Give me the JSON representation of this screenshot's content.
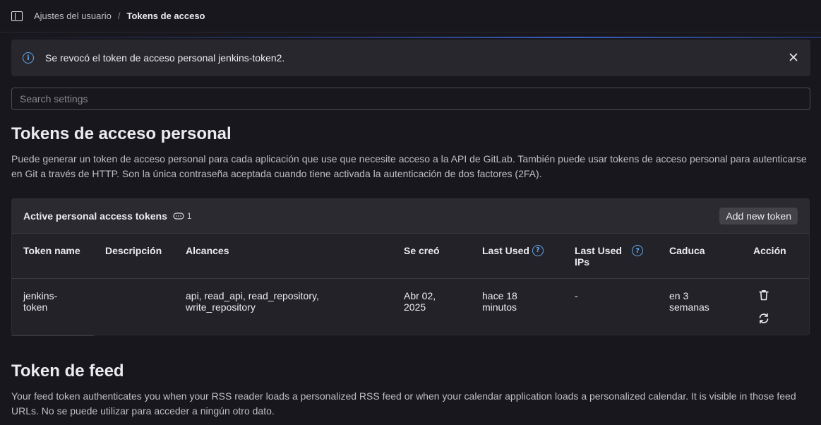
{
  "breadcrumb": {
    "parent": "Ajustes del usuario",
    "separator": "/",
    "current": "Tokens de acceso"
  },
  "alert": {
    "message": "Se revocó el token de acceso personal jenkins-token2."
  },
  "search": {
    "placeholder": "Search settings"
  },
  "pat_section": {
    "title": "Tokens de acceso personal",
    "description": "Puede generar un token de acceso personal para cada aplicación que use que necesite acceso a la API de GitLab. También puede usar tokens de acceso personal para autenticarse en Git a través de HTTP. Son la única contraseña aceptada cuando tiene activada la autenticación de dos factores (2FA)."
  },
  "tokens_card": {
    "title": "Active personal access tokens",
    "count": "1",
    "add_button": "Add new token",
    "columns": {
      "name": "Token name",
      "description": "Descripción",
      "scopes": "Alcances",
      "created": "Se creó",
      "last_used": "Last Used",
      "last_used_ips": "Last Used IPs",
      "expires": "Caduca",
      "action": "Acción"
    },
    "rows": [
      {
        "name": "jenkins-token",
        "description": "",
        "scopes": "api, read_api, read_repository, write_repository",
        "created": "Abr 02, 2025",
        "last_used": "hace 18 minutos",
        "last_used_ips": "-",
        "expires": "en 3 semanas"
      }
    ]
  },
  "feed_section": {
    "title": "Token de feed",
    "description": "Your feed token authenticates you when your RSS reader loads a personalized RSS feed or when your calendar application loads a personalized calendar. It is visible in those feed URLs. No se puede utilizar para acceder a ningún otro dato."
  },
  "colors": {
    "background": "#18171d",
    "card": "#232228",
    "info": "#63a6e9",
    "text": "#ececef"
  },
  "icons": [
    "sidebar-toggle-icon",
    "info-icon",
    "close-icon",
    "token-icon",
    "help-icon",
    "trash-icon",
    "rotate-icon"
  ]
}
